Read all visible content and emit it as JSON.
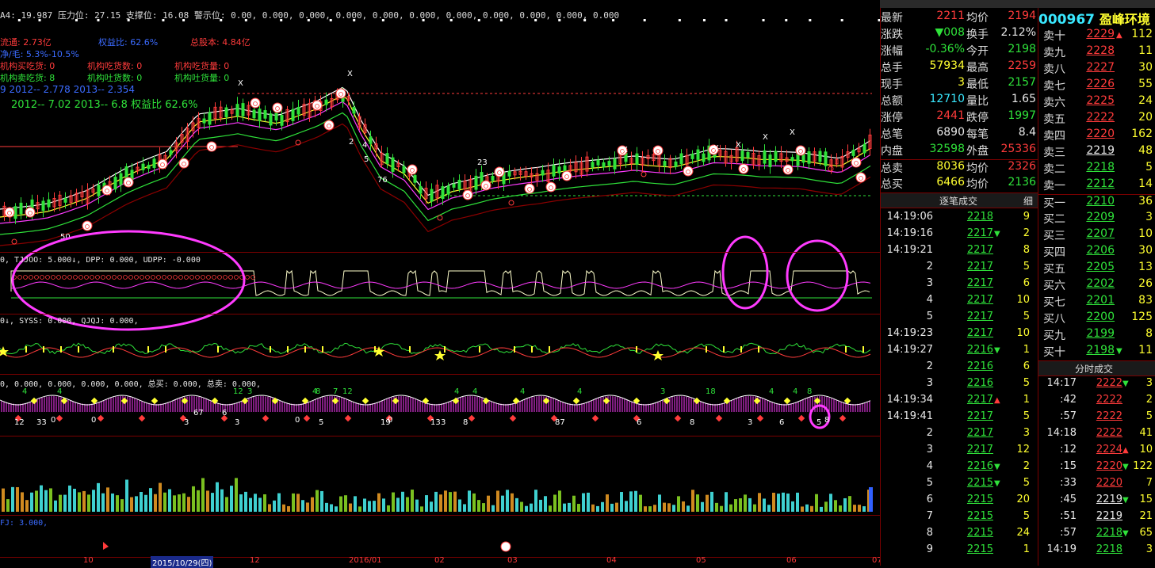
{
  "header": {
    "line1": [
      {
        "text": "A4: 19.987",
        "color": "#e8e8e8"
      },
      {
        "text": "压力位: 27.15",
        "color": "#ff3b3b"
      },
      {
        "text": "支撑位: 16.08",
        "color": "#2fe23a"
      },
      {
        "text": "警示位: 0.00, 0.000, 0.000, 0.000, 0.000,",
        "color": "#ff3bff"
      },
      {
        "text": "0.000, 0.000, 0.000, 0.000, 0.000, 0.000",
        "color": "#ff3b3b"
      }
    ],
    "fund": {
      "liutong": "流通: 2.73亿",
      "quanyi": "权益比: 62.6%",
      "zongguben": "总股本: 4.84亿",
      "jingzichan": "净/毛: 5.3%-10.5%"
    },
    "inst": [
      {
        "a": "机构买吃货: 0",
        "b": "机构吃货数: 0",
        "c": "机构吃货量: 0",
        "color": "#ff3b3b"
      },
      {
        "a": "机构卖吃货: 8",
        "b": "机构吐货数: 0",
        "c": "机构吐货量: 0",
        "color": "#2fe23a"
      }
    ],
    "eps": "9   2012-- 2.778   2013-- 2.354",
    "roe": "2012-- 7.02   2013-- 6.8   权益比 62.6%"
  },
  "panels": {
    "p2_label": "0, TJJOO: 5.000↓, DPP: 0.000, UDPP: -0.000",
    "p3_label": "0↓, SYSS: 0.000, QJQJ: 0.000,",
    "p4_label": "0, 0.000, 0.000, 0.000, 0.000, 总买: 0.000, 总卖: 0.000,",
    "p6_label": "FJ: 3.000,",
    "chart_annotations": [
      "X",
      "X",
      "2",
      "4",
      "5",
      "76",
      "50",
      "23",
      "X",
      "X",
      "X",
      "X",
      "X"
    ],
    "p4_numbers": [
      "12",
      "33",
      "0",
      "0",
      "3",
      "67",
      "6",
      "3",
      "0",
      "5",
      "19",
      "0",
      "13",
      "3",
      "8",
      "87",
      "6",
      "8",
      "3",
      "6",
      "5",
      "8",
      "4",
      "4",
      "12",
      "3",
      "4",
      "8",
      "7",
      "12",
      "4",
      "4",
      "4",
      "4",
      "3",
      "18",
      "4",
      "4",
      "8"
    ]
  },
  "date_axis": {
    "labels": [
      "10",
      "2015/10/29(四)",
      "12",
      "2016/01",
      "02",
      "03",
      "04",
      "05",
      "06",
      "07"
    ],
    "highlighted": "2015/10/29(四)"
  },
  "quote": {
    "stock_code": "000967",
    "stock_name": "盈峰环境",
    "rows": [
      {
        "l1": "最新",
        "v1": "2211",
        "c1": "#ff3b3b",
        "l2": "均价",
        "v2": "2194",
        "c2": "#ff3b3b"
      },
      {
        "l1": "涨跌",
        "v1": "▼008",
        "c1": "#2fe23a",
        "l2": "换手",
        "v2": "2.12%",
        "c2": "#e8e8e8"
      },
      {
        "l1": "涨幅",
        "v1": "-0.36%",
        "c1": "#2fe23a",
        "l2": "今开",
        "v2": "2198",
        "c2": "#2fe23a"
      },
      {
        "l1": "总手",
        "v1": "57934",
        "c1": "#ffff30",
        "l2": "最高",
        "v2": "2259",
        "c2": "#ff3b3b"
      },
      {
        "l1": "现手",
        "v1": "3",
        "c1": "#ffff30",
        "l2": "最低",
        "v2": "2157",
        "c2": "#2fe23a"
      },
      {
        "l1": "总额",
        "v1": "12710",
        "c1": "#39e8ff",
        "l2": "量比",
        "v2": "1.65",
        "c2": "#e8e8e8"
      },
      {
        "l1": "涨停",
        "v1": "2441",
        "c1": "#ff3b3b",
        "l2": "跌停",
        "v2": "1997",
        "c2": "#2fe23a"
      },
      {
        "l1": "总笔",
        "v1": "6890",
        "c1": "#e8e8e8",
        "l2": "每笔",
        "v2": "8.4",
        "c2": "#e8e8e8"
      },
      {
        "l1": "内盘",
        "v1": "32598",
        "c1": "#2fe23a",
        "l2": "外盘",
        "v2": "25336",
        "c2": "#ff3b3b"
      },
      {
        "l1": "总卖",
        "v1": "8036",
        "c1": "#ffff30",
        "l2": "均价",
        "v2": "2326",
        "c2": "#ff3b3b"
      },
      {
        "l1": "总买",
        "v1": "6466",
        "c1": "#ffff30",
        "l2": "均价",
        "v2": "2136",
        "c2": "#2fe23a"
      }
    ]
  },
  "ticks": {
    "title": "逐笔成交",
    "col": "细",
    "rows": [
      {
        "t": "14:19:06",
        "p": "2218",
        "v": "9",
        "a": ""
      },
      {
        "t": "14:19:16",
        "p": "2217",
        "v": "2",
        "a": "dn"
      },
      {
        "t": "14:19:21",
        "p": "2217",
        "v": "8",
        "a": ""
      },
      {
        "t": "2",
        "p": "2217",
        "v": "5",
        "a": ""
      },
      {
        "t": "3",
        "p": "2217",
        "v": "6",
        "a": ""
      },
      {
        "t": "4",
        "p": "2217",
        "v": "10",
        "a": ""
      },
      {
        "t": "5",
        "p": "2217",
        "v": "5",
        "a": ""
      },
      {
        "t": "14:19:23",
        "p": "2217",
        "v": "10",
        "a": ""
      },
      {
        "t": "14:19:27",
        "p": "2216",
        "v": "1",
        "a": "dn"
      },
      {
        "t": "2",
        "p": "2216",
        "v": "6",
        "a": ""
      },
      {
        "t": "3",
        "p": "2216",
        "v": "5",
        "a": ""
      },
      {
        "t": "14:19:34",
        "p": "2217",
        "v": "1",
        "a": "up"
      },
      {
        "t": "14:19:41",
        "p": "2217",
        "v": "5",
        "a": ""
      },
      {
        "t": "2",
        "p": "2217",
        "v": "3",
        "a": ""
      },
      {
        "t": "3",
        "p": "2217",
        "v": "12",
        "a": ""
      },
      {
        "t": "4",
        "p": "2216",
        "v": "2",
        "a": "dn"
      },
      {
        "t": "5",
        "p": "2215",
        "v": "5",
        "a": "dn"
      },
      {
        "t": "6",
        "p": "2215",
        "v": "20",
        "a": ""
      },
      {
        "t": "7",
        "p": "2215",
        "v": "5",
        "a": ""
      },
      {
        "t": "8",
        "p": "2215",
        "v": "24",
        "a": ""
      },
      {
        "t": "9",
        "p": "2215",
        "v": "1",
        "a": ""
      }
    ]
  },
  "depth": {
    "sell": [
      {
        "l": "卖十",
        "p": "2229",
        "v": "112",
        "c": "#ff3b3b",
        "a": "up"
      },
      {
        "l": "卖九",
        "p": "2228",
        "v": "11",
        "c": "#ff3b3b",
        "a": ""
      },
      {
        "l": "卖八",
        "p": "2227",
        "v": "30",
        "c": "#ff3b3b",
        "a": ""
      },
      {
        "l": "卖七",
        "p": "2226",
        "v": "55",
        "c": "#ff3b3b",
        "a": ""
      },
      {
        "l": "卖六",
        "p": "2225",
        "v": "24",
        "c": "#ff3b3b",
        "a": ""
      },
      {
        "l": "卖五",
        "p": "2222",
        "v": "20",
        "c": "#ff3b3b",
        "a": ""
      },
      {
        "l": "卖四",
        "p": "2220",
        "v": "162",
        "c": "#ff3b3b",
        "a": ""
      },
      {
        "l": "卖三",
        "p": "2219",
        "v": "48",
        "c": "#e8e8e8",
        "a": ""
      },
      {
        "l": "卖二",
        "p": "2218",
        "v": "5",
        "c": "#2fe23a",
        "a": ""
      },
      {
        "l": "卖一",
        "p": "2212",
        "v": "14",
        "c": "#2fe23a",
        "a": ""
      }
    ],
    "buy": [
      {
        "l": "买一",
        "p": "2210",
        "v": "36",
        "c": "#2fe23a",
        "a": ""
      },
      {
        "l": "买二",
        "p": "2209",
        "v": "3",
        "c": "#2fe23a",
        "a": ""
      },
      {
        "l": "买三",
        "p": "2207",
        "v": "10",
        "c": "#2fe23a",
        "a": ""
      },
      {
        "l": "买四",
        "p": "2206",
        "v": "30",
        "c": "#2fe23a",
        "a": ""
      },
      {
        "l": "买五",
        "p": "2205",
        "v": "13",
        "c": "#2fe23a",
        "a": ""
      },
      {
        "l": "买六",
        "p": "2202",
        "v": "26",
        "c": "#2fe23a",
        "a": ""
      },
      {
        "l": "买七",
        "p": "2201",
        "v": "83",
        "c": "#2fe23a",
        "a": ""
      },
      {
        "l": "买八",
        "p": "2200",
        "v": "125",
        "c": "#2fe23a",
        "a": ""
      },
      {
        "l": "买九",
        "p": "2199",
        "v": "8",
        "c": "#2fe23a",
        "a": ""
      },
      {
        "l": "买十",
        "p": "2198",
        "v": "11",
        "c": "#2fe23a",
        "a": "dn"
      }
    ]
  },
  "fenshi": {
    "title": "分时成交",
    "rows": [
      {
        "t": "14:17",
        "p": "2222",
        "v": "3",
        "c": "#ff3b3b",
        "a": "dn"
      },
      {
        "t": ":42",
        "p": "2222",
        "v": "2",
        "c": "#ff3b3b",
        "a": ""
      },
      {
        "t": ":57",
        "p": "2222",
        "v": "5",
        "c": "#ff3b3b",
        "a": ""
      },
      {
        "t": "14:18",
        "p": "2222",
        "v": "41",
        "c": "#ff3b3b",
        "a": ""
      },
      {
        "t": ":12",
        "p": "2224",
        "v": "10",
        "c": "#ff3b3b",
        "a": "up"
      },
      {
        "t": ":15",
        "p": "2220",
        "v": "122",
        "c": "#ff3b3b",
        "a": "dn"
      },
      {
        "t": ":33",
        "p": "2220",
        "v": "7",
        "c": "#ff3b3b",
        "a": ""
      },
      {
        "t": ":45",
        "p": "2219",
        "v": "15",
        "c": "#e8e8e8",
        "a": "dn"
      },
      {
        "t": ":51",
        "p": "2219",
        "v": "21",
        "c": "#e8e8e8",
        "a": ""
      },
      {
        "t": ":57",
        "p": "2218",
        "v": "65",
        "c": "#2fe23a",
        "a": "dn"
      },
      {
        "t": "14:19",
        "p": "2218",
        "v": "3",
        "c": "#2fe23a",
        "a": ""
      }
    ]
  },
  "colors": {
    "up": "#ff3b3b",
    "down": "#2fe23a",
    "volume": "#ffff30",
    "grid": "#7a0000",
    "ma5": "#ffffff",
    "ma10": "#ffff30",
    "ma20": "#ff3bff",
    "ma60": "#2fe23a",
    "highlight_ring": "#ff3bff"
  }
}
